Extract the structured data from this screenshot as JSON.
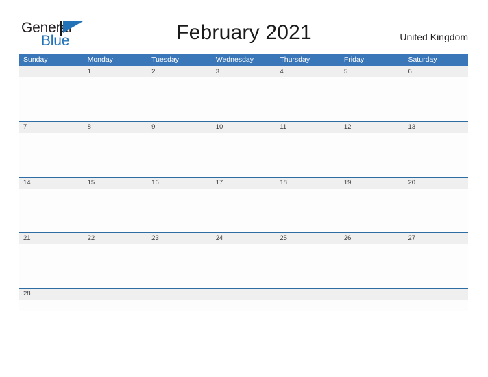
{
  "brand": {
    "name_part1": "General",
    "name_part2": "Blue",
    "flag_icon": "blue-flag-triangle-icon",
    "accent_color": "#2272b8"
  },
  "header": {
    "title": "February 2021",
    "region": "United Kingdom"
  },
  "calendar": {
    "colors": {
      "header_blue": "#3a77b8",
      "row_divider_blue": "#2e6da4",
      "date_strip_gray": "#efefef",
      "cell_white": "#fdfdfd"
    },
    "weekdays": [
      "Sunday",
      "Monday",
      "Tuesday",
      "Wednesday",
      "Thursday",
      "Friday",
      "Saturday"
    ],
    "weeks": [
      {
        "days": [
          "",
          "1",
          "2",
          "3",
          "4",
          "5",
          "6"
        ]
      },
      {
        "days": [
          "7",
          "8",
          "9",
          "10",
          "11",
          "12",
          "13"
        ]
      },
      {
        "days": [
          "14",
          "15",
          "16",
          "17",
          "18",
          "19",
          "20"
        ]
      },
      {
        "days": [
          "21",
          "22",
          "23",
          "24",
          "25",
          "26",
          "27"
        ]
      },
      {
        "days": [
          "28",
          "",
          "",
          "",
          "",
          "",
          ""
        ]
      }
    ]
  }
}
